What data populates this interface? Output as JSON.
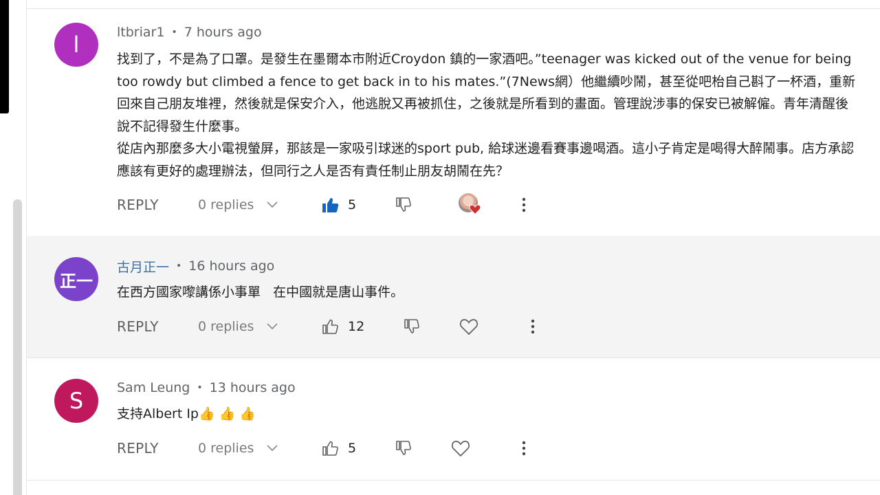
{
  "colors": {
    "avatar_purple": "#b02fbf",
    "avatar_violet": "#7b43c9",
    "avatar_magenta": "#c0185d",
    "like_active": "#1565c0",
    "heart_red": "#d32f2f"
  },
  "comments": [
    {
      "author": "ltbriar1",
      "avatar_letter": "l",
      "time": "7 hours ago",
      "paragraphs": [
        "找到了，不是為了口罩。是發生在墨爾本市附近Croydon 鎮的一家酒吧。”teenager was kicked out of the venue for being too rowdy but climbed a fence to get back in to his mates.”(7News網）他繼續吵鬧，甚至從吧枱自己斟了一杯酒，重新回來自己朋友堆裡，然後就是保安介入，他逃脫又再被抓住，之後就是所看到的畫面。管理說涉事的保安已被解僱。青年清醒後說不記得發生什麼事。",
        "從店內那麼多大小電視螢屏，那該是一家吸引球迷的sport pub, 給球迷邊看賽事邊喝酒。這小子肯定是喝得大醉鬧事。店方承認應該有更好的處理辦法，但同行之人是否有責任制止朋友胡鬧在先？"
      ],
      "reply_label": "REPLY",
      "replies": "0 replies",
      "likes": "5",
      "liked": true,
      "creator_hearted": true
    },
    {
      "author": "古月正一",
      "avatar_letter": "正一",
      "time": "16 hours ago",
      "paragraphs": [
        "在西方國家嚟講係小事單   在中國就是唐山事件。"
      ],
      "reply_label": "REPLY",
      "replies": "0 replies",
      "likes": "12",
      "liked": false,
      "creator_hearted": false
    },
    {
      "author": "Sam Leung",
      "avatar_letter": "S",
      "time": "13 hours ago",
      "paragraphs": [
        "支持Albert Ip👍 👍 👍"
      ],
      "reply_label": "REPLY",
      "replies": "0 replies",
      "likes": "5",
      "liked": false,
      "creator_hearted": false
    }
  ]
}
